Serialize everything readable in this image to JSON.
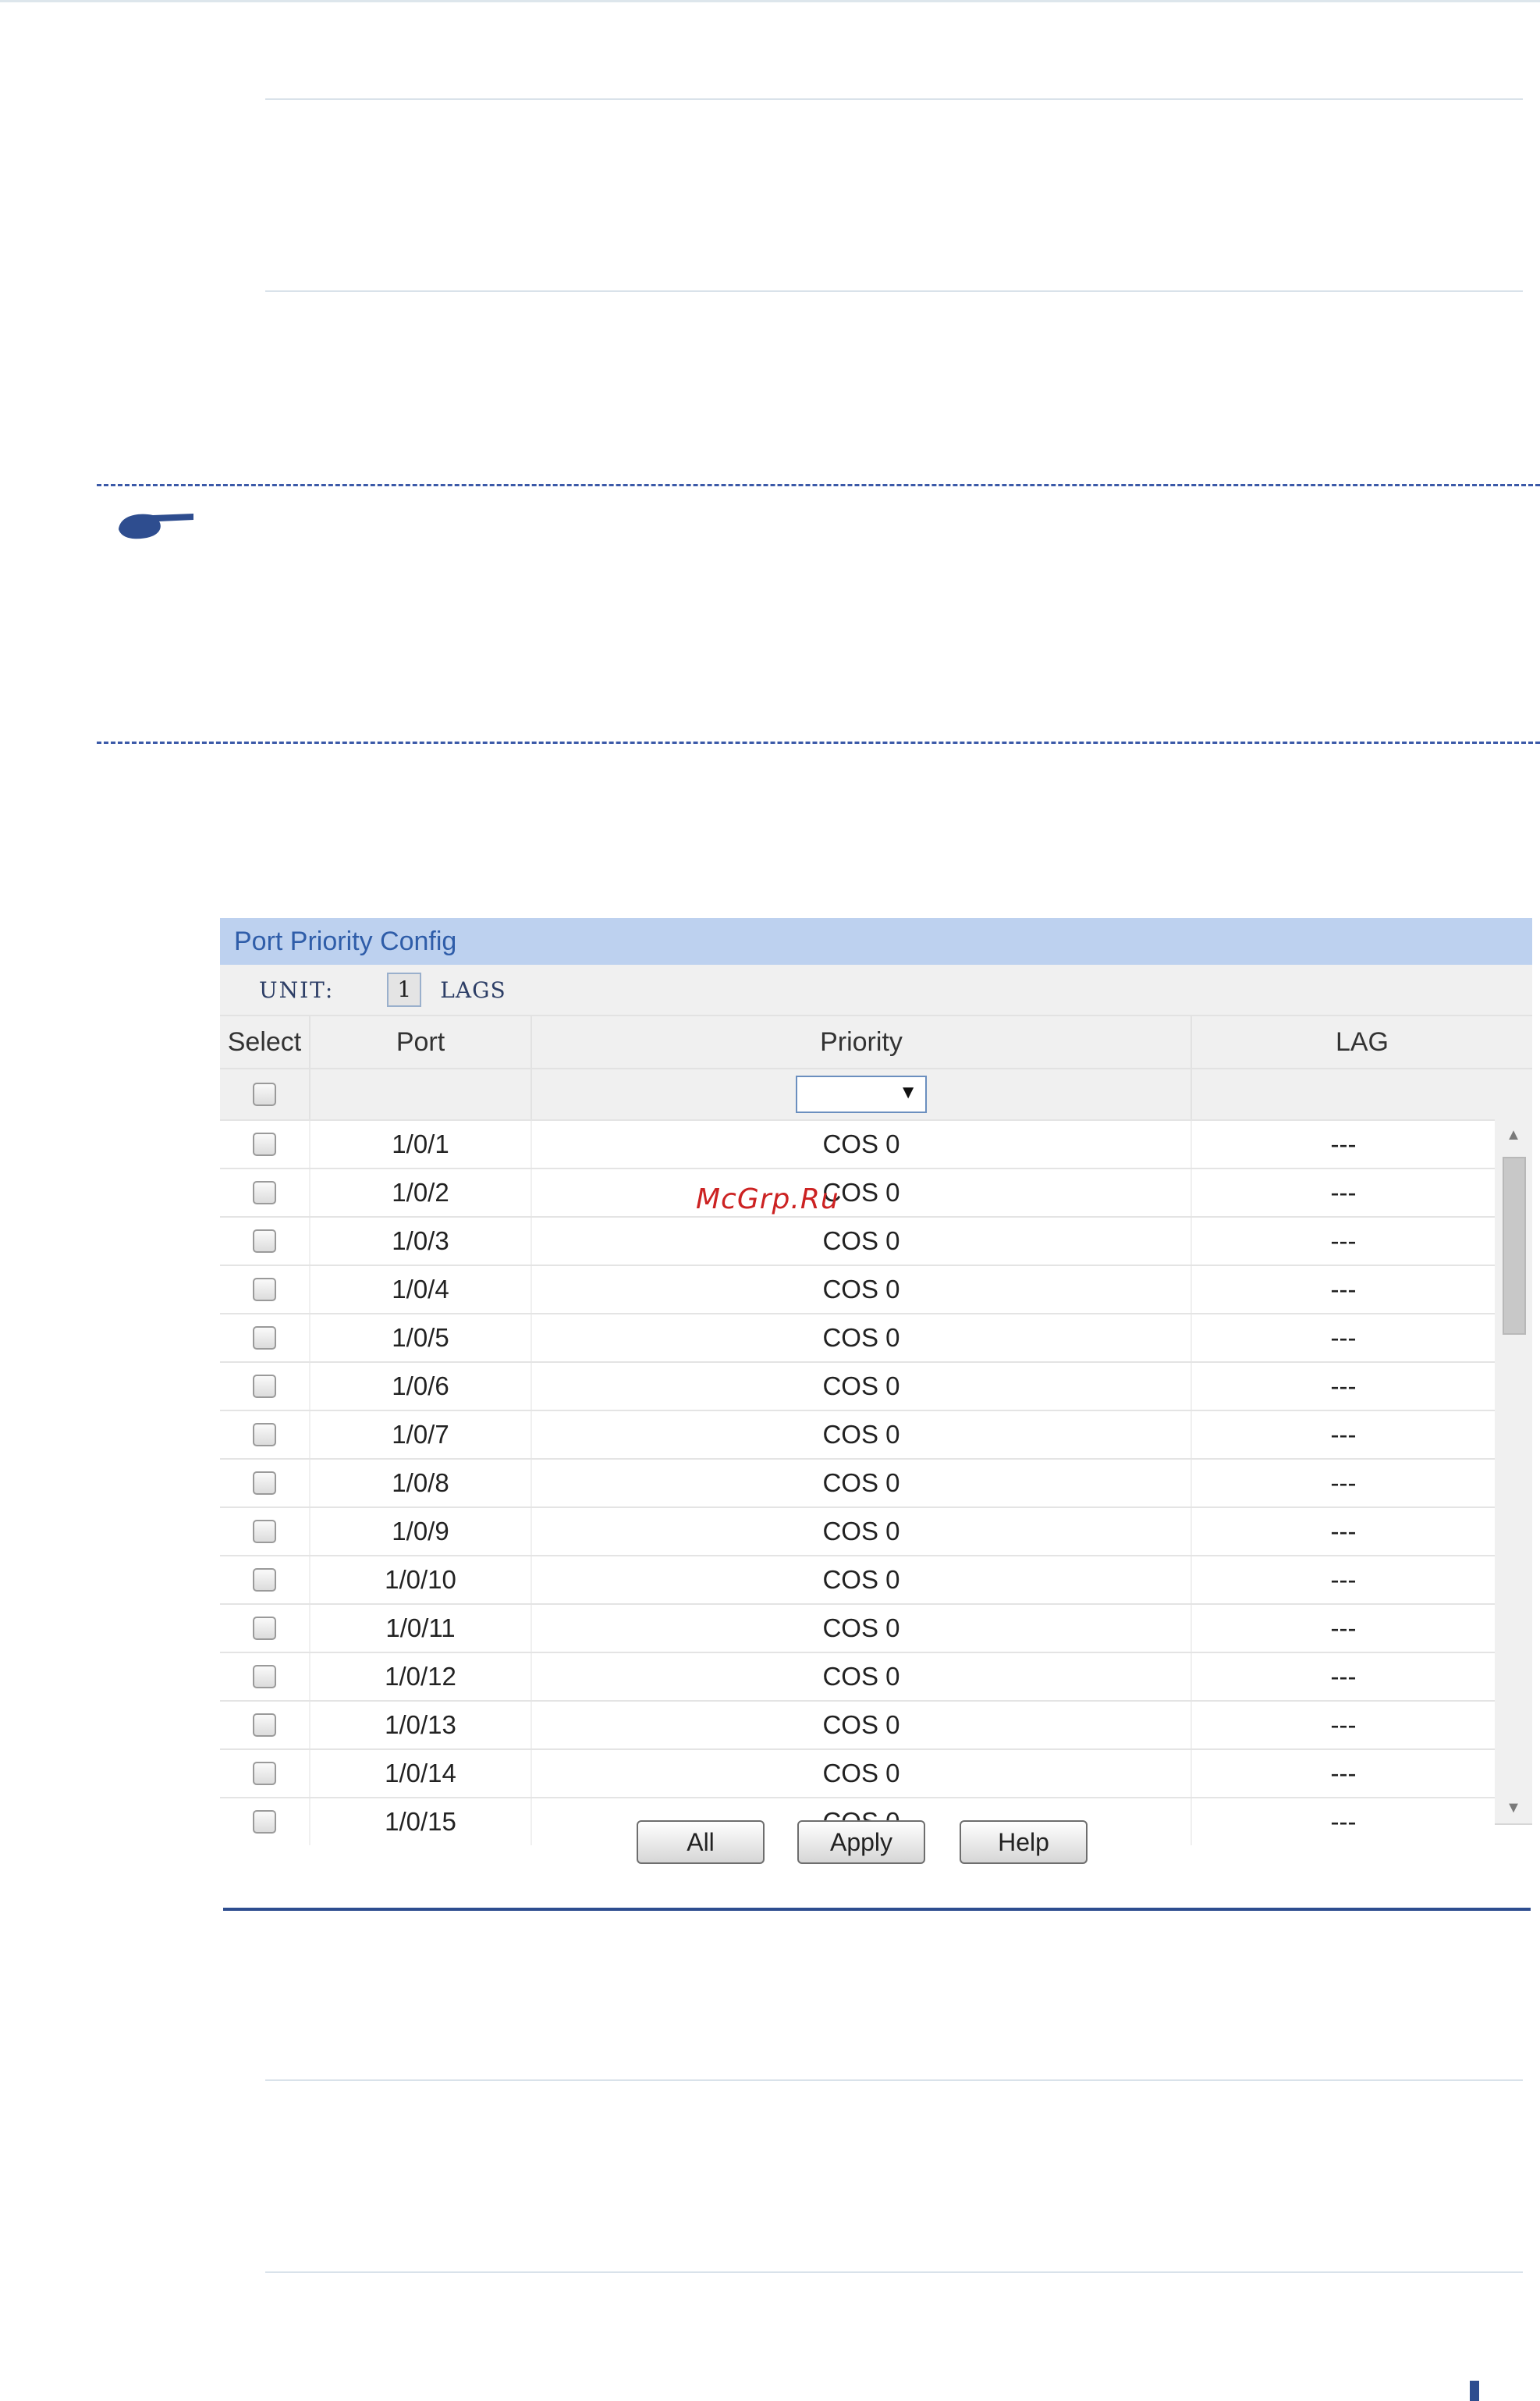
{
  "colors": {
    "panel_title_bg": "#bdd1ef",
    "panel_title_text": "#2f5da9",
    "accent_blue": "#2e4d8f",
    "watermark_red": "#cc2222"
  },
  "icons": {
    "note": "pointing-hand-icon",
    "dropdown": "triangle-down-icon",
    "scroll_up": "triangle-up-icon",
    "scroll_down": "triangle-down-icon"
  },
  "panel": {
    "title": "Port Priority Config",
    "unit_label": "UNIT:",
    "unit_value": "1",
    "lags_label": "LAGS"
  },
  "table": {
    "headers": {
      "select": "Select",
      "port": "Port",
      "priority": "Priority",
      "lag": "LAG"
    },
    "filter_priority_value": "",
    "rows": [
      {
        "port": "1/0/1",
        "priority": "COS 0",
        "lag": "---"
      },
      {
        "port": "1/0/2",
        "priority": "COS 0",
        "lag": "---"
      },
      {
        "port": "1/0/3",
        "priority": "COS 0",
        "lag": "---"
      },
      {
        "port": "1/0/4",
        "priority": "COS 0",
        "lag": "---"
      },
      {
        "port": "1/0/5",
        "priority": "COS 0",
        "lag": "---"
      },
      {
        "port": "1/0/6",
        "priority": "COS 0",
        "lag": "---"
      },
      {
        "port": "1/0/7",
        "priority": "COS 0",
        "lag": "---"
      },
      {
        "port": "1/0/8",
        "priority": "COS 0",
        "lag": "---"
      },
      {
        "port": "1/0/9",
        "priority": "COS 0",
        "lag": "---"
      },
      {
        "port": "1/0/10",
        "priority": "COS 0",
        "lag": "---"
      },
      {
        "port": "1/0/11",
        "priority": "COS 0",
        "lag": "---"
      },
      {
        "port": "1/0/12",
        "priority": "COS 0",
        "lag": "---"
      },
      {
        "port": "1/0/13",
        "priority": "COS 0",
        "lag": "---"
      },
      {
        "port": "1/0/14",
        "priority": "COS 0",
        "lag": "---"
      },
      {
        "port": "1/0/15",
        "priority": "COS 0",
        "lag": "---"
      }
    ]
  },
  "buttons": {
    "all": "All",
    "apply": "Apply",
    "help": "Help"
  },
  "watermark": "McGrp.Ru"
}
